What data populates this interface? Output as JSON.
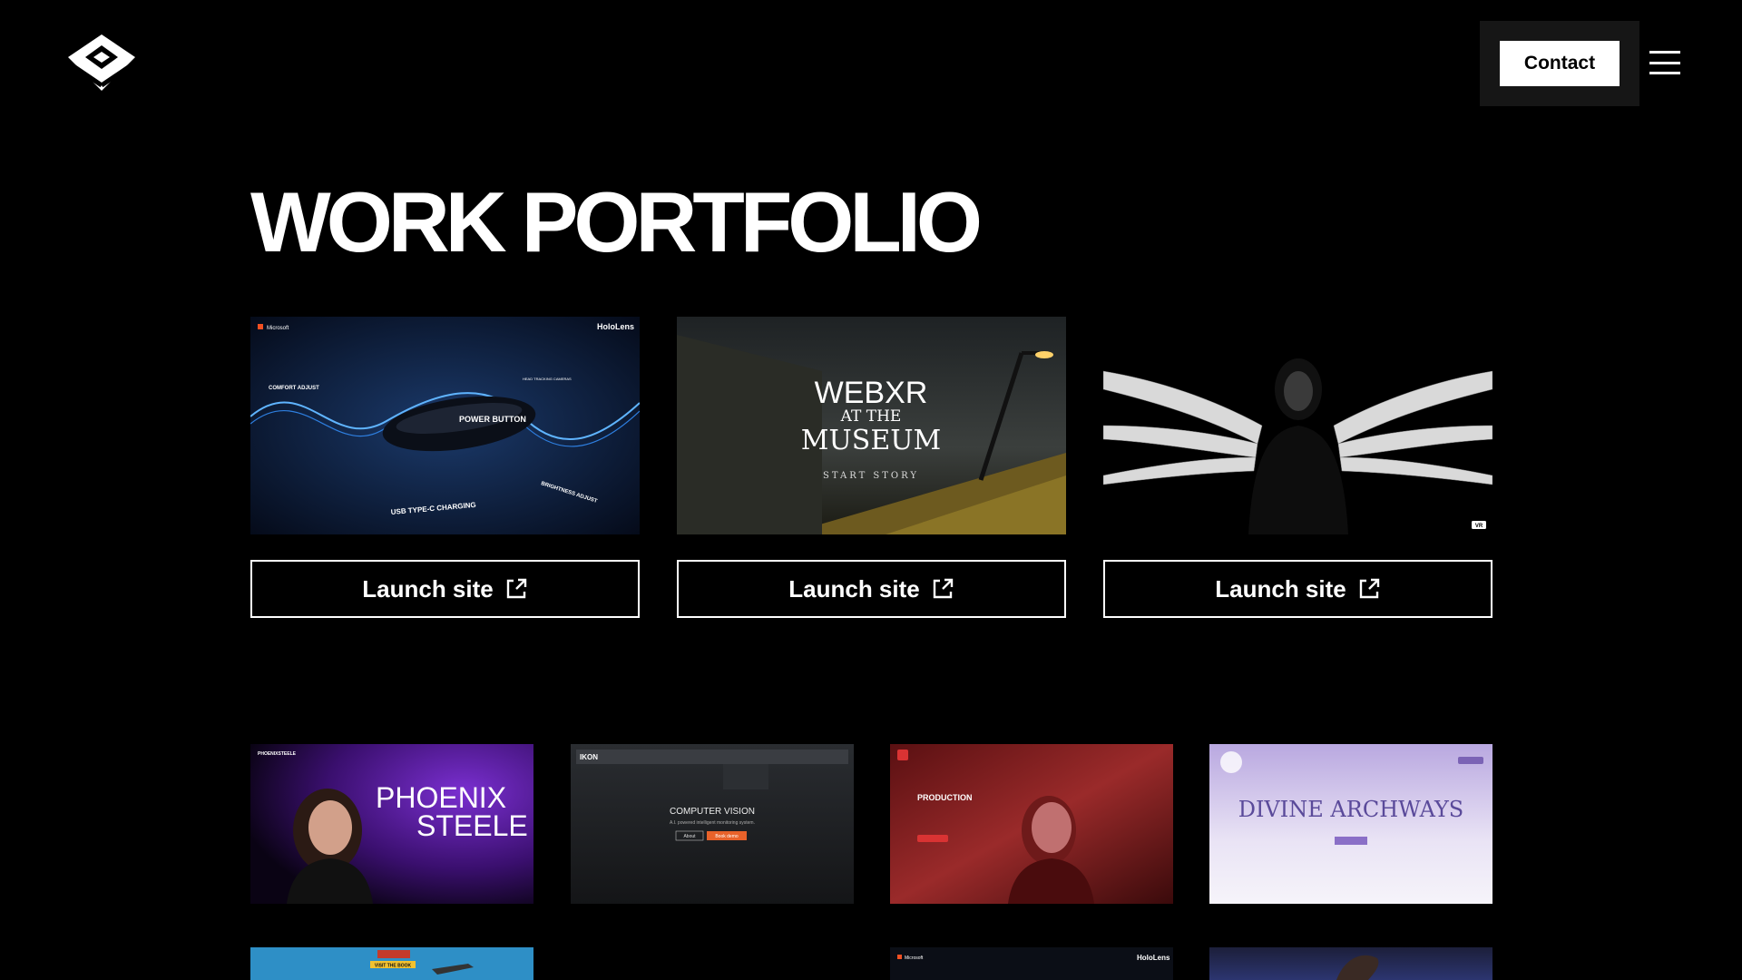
{
  "header": {
    "logo_icon": "diamond-logo-icon",
    "contact_label": "Contact",
    "menu_icon": "hamburger-menu-icon"
  },
  "page": {
    "title": "WORK PORTFOLIO"
  },
  "featured": [
    {
      "id": "hololens",
      "brand": "Microsoft",
      "product": "HoloLens",
      "callouts": [
        "COMFORT ADJUST",
        "HEAD TRACKING CAMERAS",
        "POWER BUTTON",
        "BRIGHTNESS ADJUST",
        "USB TYPE-C CHARGING"
      ],
      "launch_label": "Launch site"
    },
    {
      "id": "webxr-museum",
      "line1": "WEBXR",
      "line2": "AT THE",
      "line3": "MUSEUM",
      "cta": "START STORY",
      "launch_label": "Launch site"
    },
    {
      "id": "winged-figure",
      "badge": "VR",
      "launch_label": "Launch site"
    }
  ],
  "grid": [
    {
      "id": "phoenix-steele",
      "brand": "PHOENIXSTEELE",
      "line1": "PHOENIX",
      "line2": "STEELE"
    },
    {
      "id": "ikon-computer-vision",
      "brand": "IKON",
      "heading": "COMPUTER VISION",
      "sub": "A.I. powered intelligent monitoring system.",
      "btn1": "About",
      "btn2": "Book demo"
    },
    {
      "id": "production",
      "heading": "PRODUCTION"
    },
    {
      "id": "divine-archways",
      "heading": "DIVINE ARCHWAYS"
    },
    {
      "id": "visit-the-bar",
      "badge": "VISIT THE BOOK"
    },
    {
      "id": "hololens-2",
      "brand": "Microsoft",
      "product": "HoloLens"
    },
    {
      "id": "stage-render"
    }
  ],
  "colors": {
    "background": "#000000",
    "text": "#ffffff",
    "contact_panel": "#161616",
    "phoenix_purple": "#5b1a9c",
    "production_red": "#8c1d20",
    "archways_lavender": "#c9bde6",
    "ikon_orange": "#e8622a"
  }
}
